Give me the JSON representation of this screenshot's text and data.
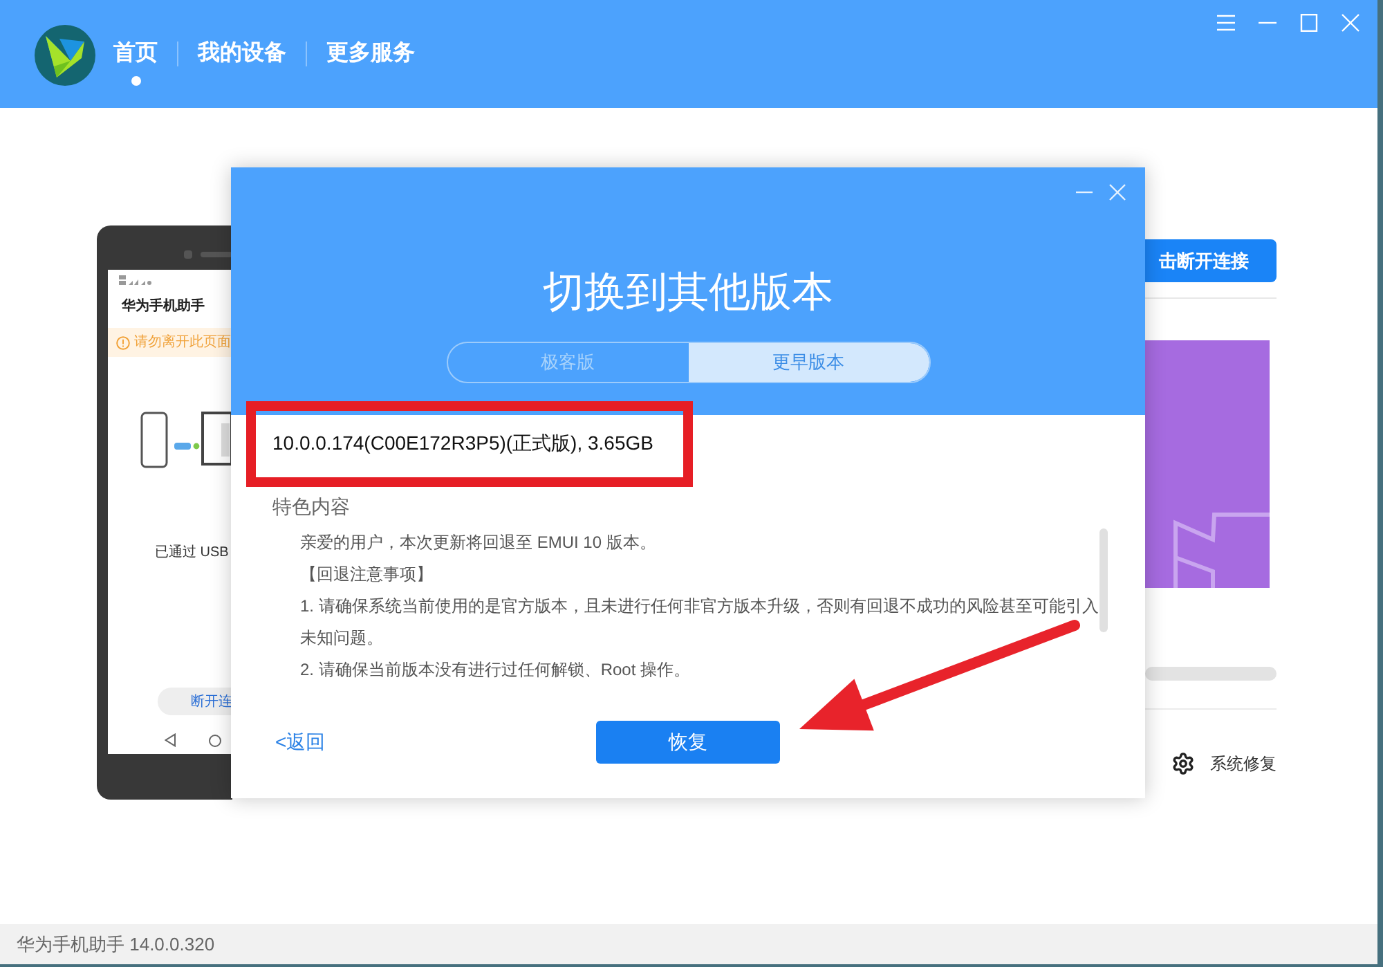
{
  "header": {
    "nav": [
      {
        "label": "首页",
        "selected": true
      },
      {
        "label": "我的设备",
        "selected": false
      },
      {
        "label": "更多服务",
        "selected": false
      }
    ]
  },
  "phone": {
    "app_title": "华为手机助手",
    "warning": "请勿离开此页面",
    "status": "已通过 USB",
    "button": "断开连"
  },
  "side_panel": {
    "button": "击断开连接",
    "repair": "系统修复"
  },
  "dialog": {
    "title": "切换到其他版本",
    "tabs": [
      {
        "label": "极客版",
        "selected": false
      },
      {
        "label": "更早版本",
        "selected": true
      }
    ],
    "version": "10.0.0.174(C00E172R3P5)(正式版), 3.65GB",
    "section_title": "特色内容",
    "notes": [
      "亲爱的用户，本次更新将回退至 EMUI 10 版本。",
      "【回退注意事项】",
      "1. 请确保系统当前使用的是官方版本，且未进行任何非官方版本升级，否则有回退不成功的风险甚至可能引入未知问题。",
      "2. 请确保当前版本没有进行过任何解锁、Root 操作。"
    ],
    "back_link": "<返回",
    "primary_button": "恢复"
  },
  "status_bar": {
    "text": "华为手机助手 14.0.0.320"
  }
}
